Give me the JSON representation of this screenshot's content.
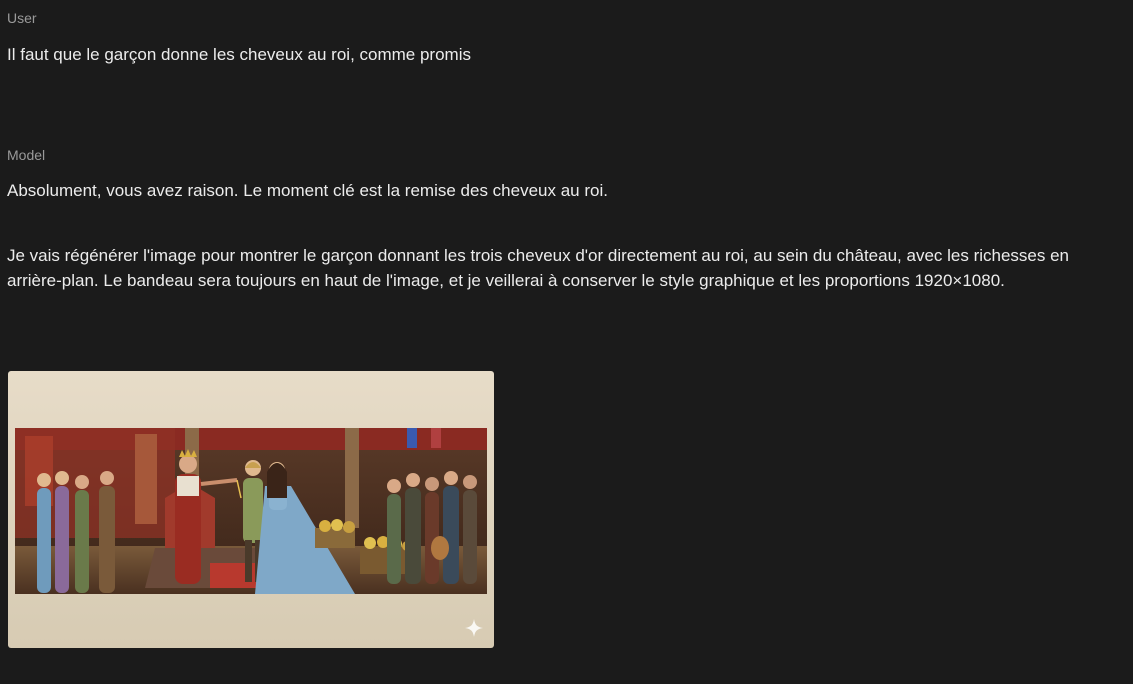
{
  "conversation": {
    "user_role": "User",
    "user_message": "Il faut que le garçon donne les cheveux au roi, comme promis",
    "model_role": "Model",
    "model_paragraph_1": "Absolument, vous avez raison. Le moment clé est la remise des cheveux au roi.",
    "model_paragraph_2": "Je vais régénérer l'image pour montrer le garçon donnant les trois cheveux d'or directement au roi, au sein du château, avec les richesses en arrière-plan. Le bandeau sera toujours en haut de l'image, et je veillerai à conserver le style graphique et les proportions 1920×1080."
  },
  "generated_image": {
    "icon": "sparkle-icon"
  }
}
